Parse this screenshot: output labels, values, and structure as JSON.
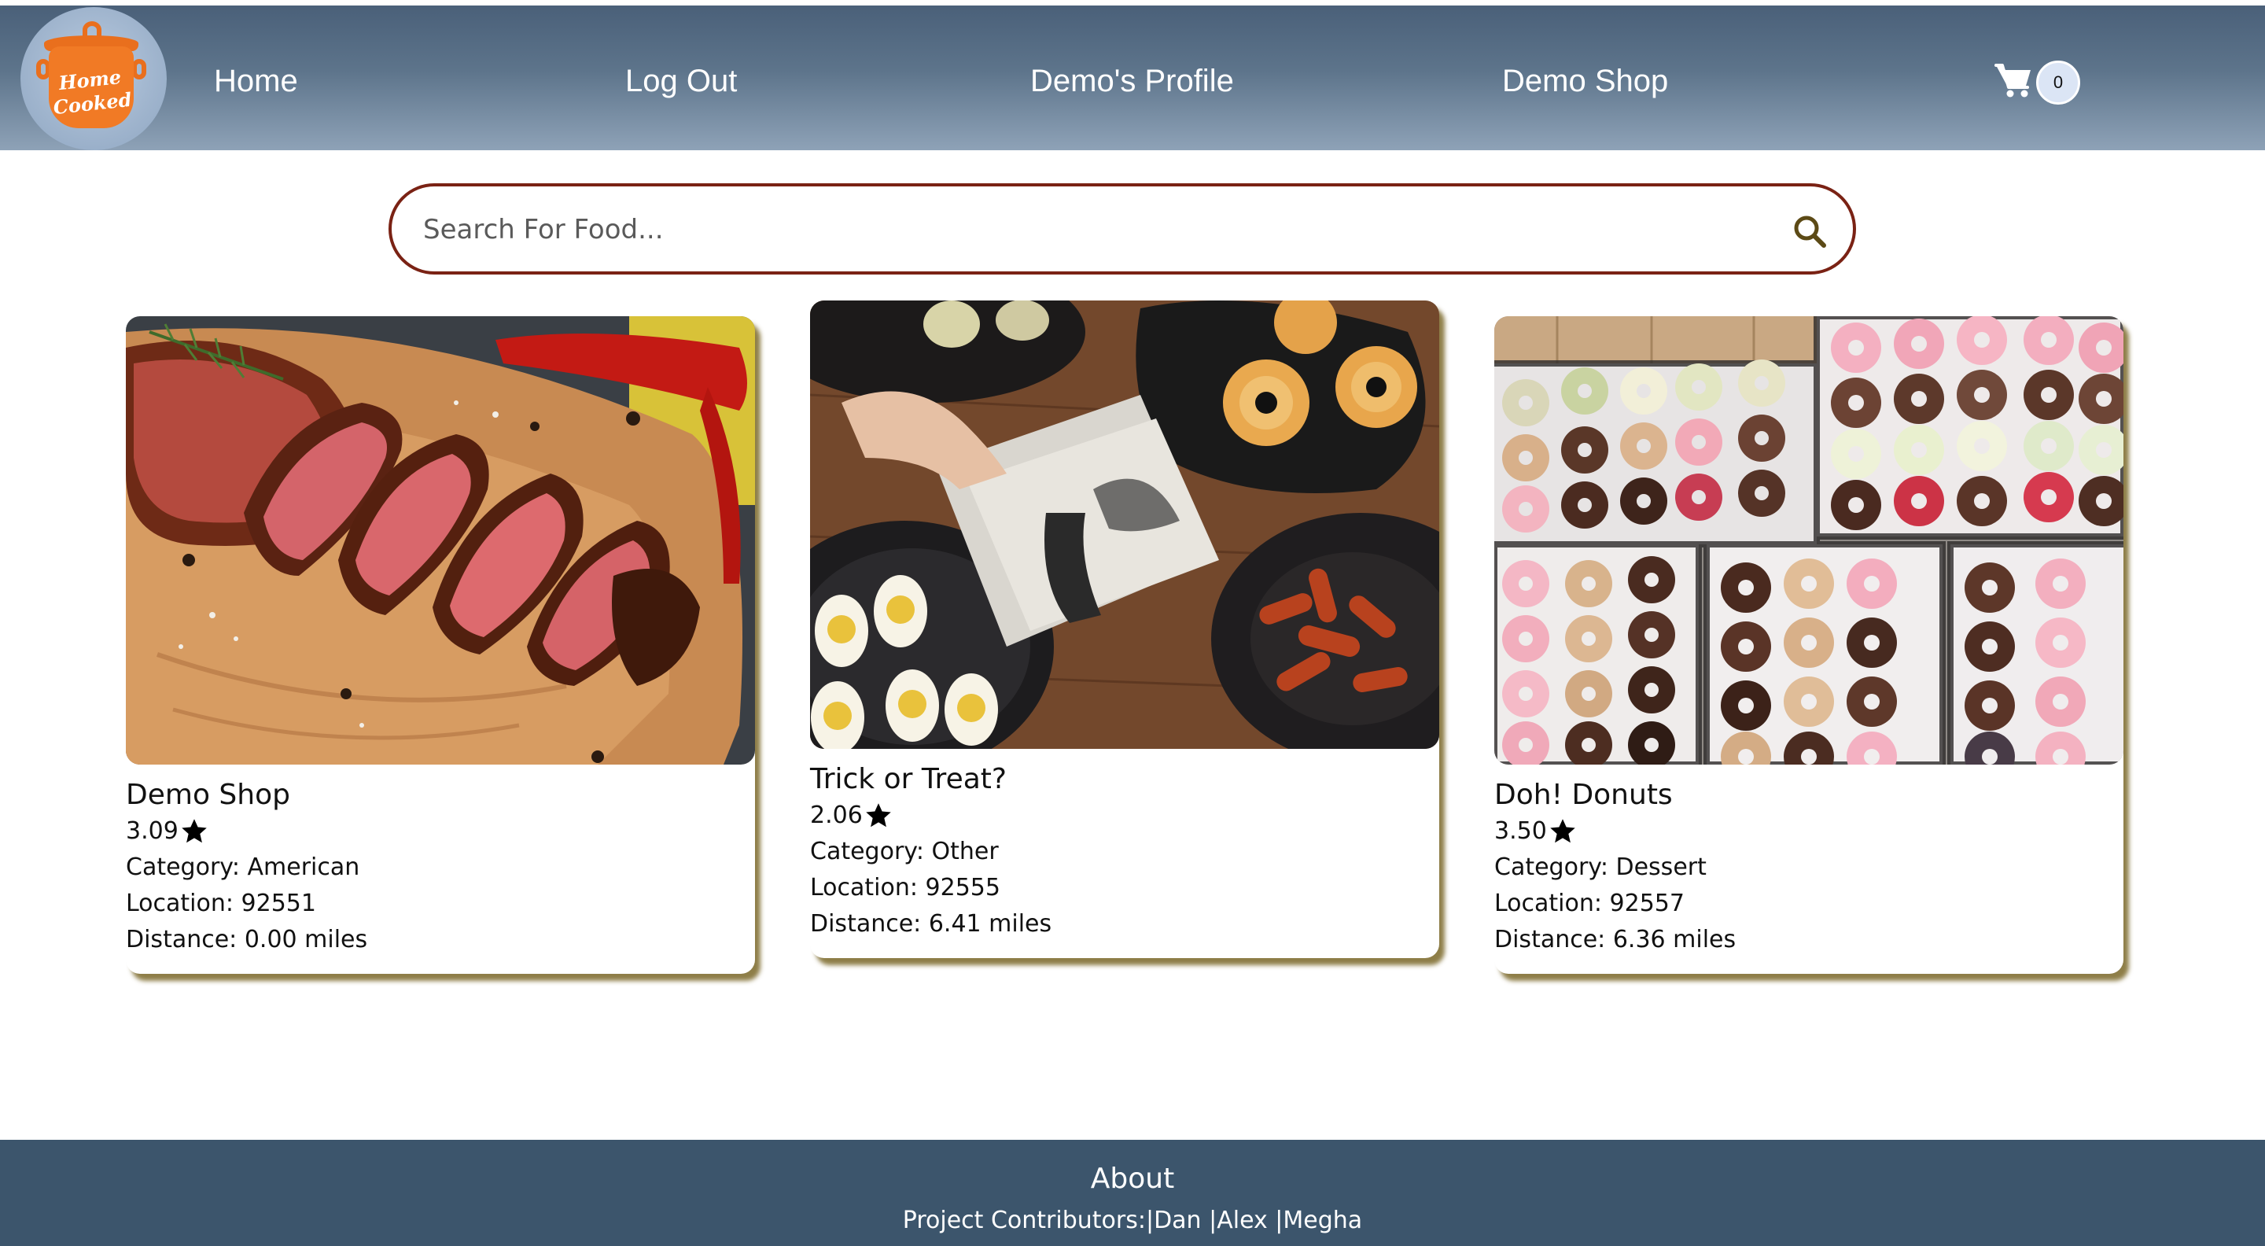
{
  "navbar": {
    "logo_text_line1": "Home",
    "logo_text_line2": "Cooked",
    "links": [
      {
        "label": "Home"
      },
      {
        "label": "Log Out"
      },
      {
        "label": "Demo's Profile"
      },
      {
        "label": "Demo Shop"
      }
    ],
    "cart": {
      "icon": "shopping-cart-icon",
      "count": "0"
    }
  },
  "search": {
    "placeholder": "Search For Food...",
    "value": "",
    "icon": "search-icon"
  },
  "cards": [
    {
      "image": "steak-on-cutting-board",
      "title": "Demo Shop",
      "rating": "3.09",
      "category": "Category: American",
      "location": "Location: 92551",
      "distance": "Distance: 0.00 miles"
    },
    {
      "image": "halloween-party-food",
      "title": "Trick or Treat?",
      "rating": "2.06",
      "category": "Category: Other",
      "location": "Location: 92555",
      "distance": "Distance: 6.41 miles"
    },
    {
      "image": "trays-of-donuts",
      "title": "Doh! Donuts",
      "rating": "3.50",
      "category": "Category: Dessert",
      "location": "Location: 92557",
      "distance": "Distance: 6.36 miles"
    }
  ],
  "footer": {
    "title": "About",
    "contributors": "Project Contributors:|Dan |Alex |Megha"
  },
  "colors": {
    "navbar": "#5d748b",
    "search_border": "#7a2214",
    "card_shadow": "#6e5a14",
    "footer": "#3c556c"
  }
}
